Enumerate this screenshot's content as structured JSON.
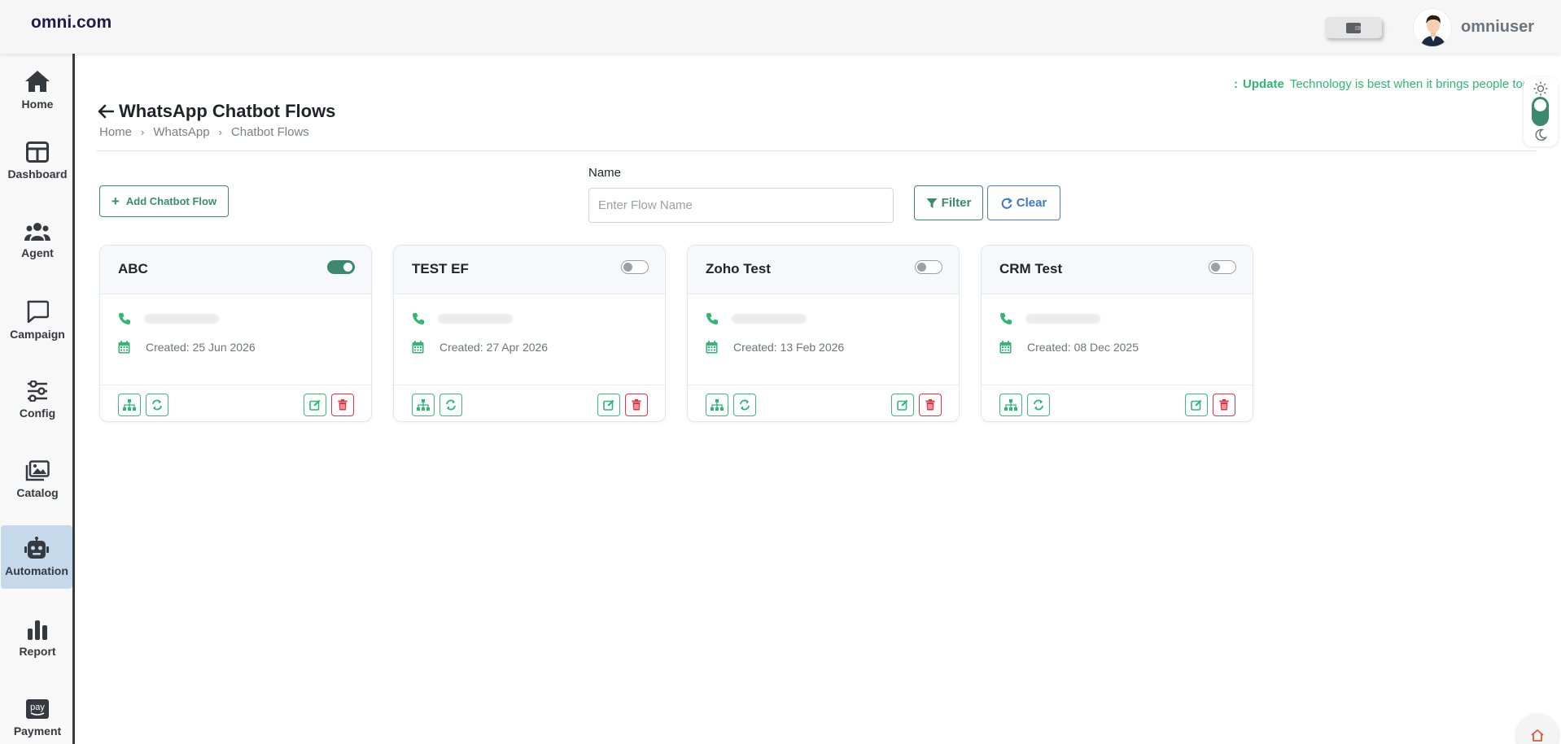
{
  "brand": "omni.com",
  "user": {
    "name": "omniuser"
  },
  "sidebar": {
    "items": [
      {
        "label": "Home",
        "icon": "home-icon"
      },
      {
        "label": "Dashboard",
        "icon": "dashboard-icon"
      },
      {
        "label": "Agent",
        "icon": "users-icon"
      },
      {
        "label": "Campaign",
        "icon": "message-icon"
      },
      {
        "label": "Config",
        "icon": "sliders-icon"
      },
      {
        "label": "Catalog",
        "icon": "images-icon"
      },
      {
        "label": "Automation",
        "icon": "robot-icon",
        "active": true
      },
      {
        "label": "Report",
        "icon": "bar-chart-icon"
      },
      {
        "label": "Payment",
        "icon": "amazon-pay-icon"
      }
    ]
  },
  "ticker": {
    "prefix": ":",
    "label": "Update",
    "text": "Technology is best when it brings people together."
  },
  "page": {
    "title": "WhatsApp Chatbot Flows",
    "breadcrumb": [
      "Home",
      "WhatsApp",
      "Chatbot Flows"
    ]
  },
  "toolbar": {
    "add_label": "Add Chatbot Flow",
    "name_label": "Name",
    "name_placeholder": "Enter Flow Name",
    "name_value": "",
    "filter_label": "Filter",
    "clear_label": "Clear"
  },
  "cards": [
    {
      "title": "ABC",
      "enabled": true,
      "created": "Created: 25 Jun 2026"
    },
    {
      "title": "TEST EF",
      "enabled": false,
      "created": "Created: 27 Apr 2026"
    },
    {
      "title": "Zoho Test",
      "enabled": false,
      "created": "Created: 13 Feb 2026"
    },
    {
      "title": "CRM Test",
      "enabled": false,
      "created": "Created: 08 Dec 2025"
    }
  ],
  "colors": {
    "accent": "#3c8a6e",
    "icon_green": "#2eb872",
    "danger": "#dc3545",
    "link_blue": "#3f78c4",
    "active_nav": "#c6d9ea"
  }
}
